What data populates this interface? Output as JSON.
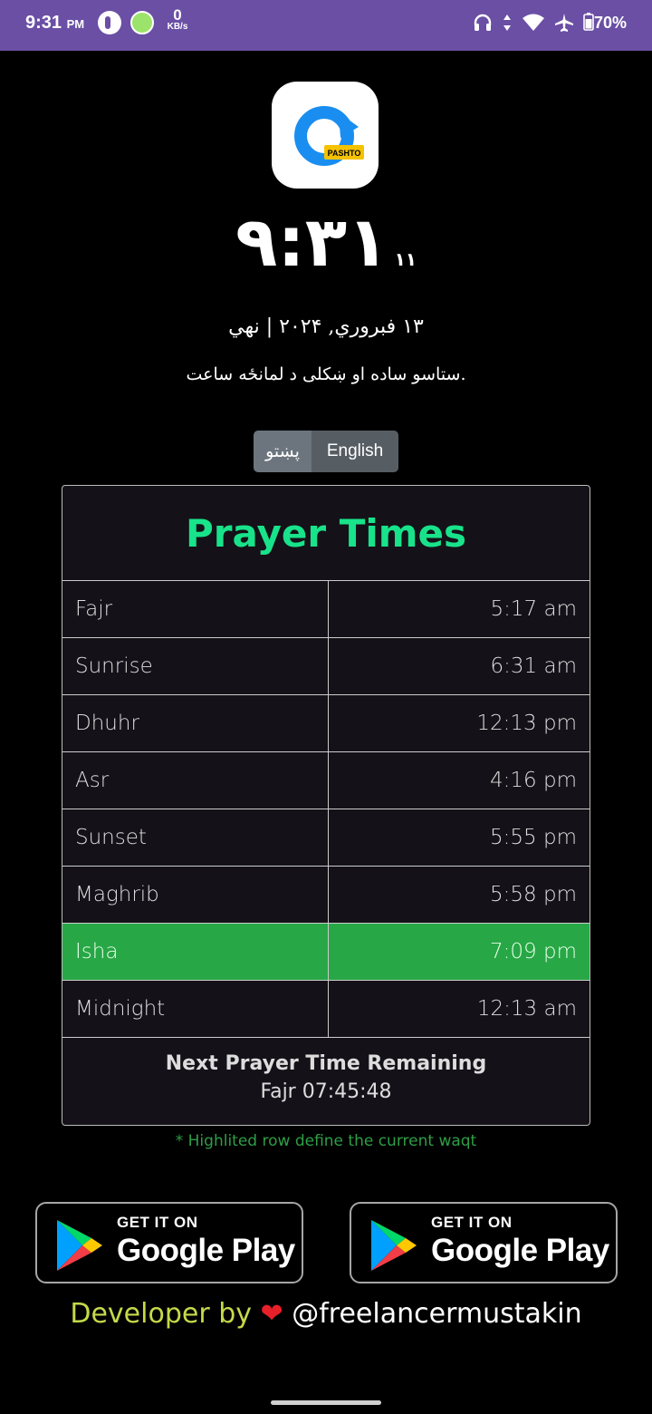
{
  "status_bar": {
    "time": "9:31",
    "ampm": "PM",
    "net_speed_value": "0",
    "net_speed_unit": "KB/s",
    "battery": "70%"
  },
  "app_icon": {
    "badge": "PASHTO"
  },
  "clock": {
    "main": "٩:٣١",
    "seconds": "١١"
  },
  "date": "١٣ فبروري, ٢٠٢۴ | نهي",
  "tagline": "ستاسو ساده او ښکلی د لمانځه ساعت.",
  "language": {
    "pashto": "پښتو",
    "english": "English"
  },
  "prayer_table": {
    "title": "Prayer Times",
    "rows": [
      {
        "name": "Fajr",
        "time": "5:17 am"
      },
      {
        "name": "Sunrise",
        "time": "6:31 am"
      },
      {
        "name": "Dhuhr",
        "time": "12:13 pm"
      },
      {
        "name": "Asr",
        "time": "4:16 pm"
      },
      {
        "name": "Sunset",
        "time": "5:55 pm"
      },
      {
        "name": "Maghrib",
        "time": "5:58 pm"
      },
      {
        "name": "Isha",
        "time": "7:09 pm"
      },
      {
        "name": "Midnight",
        "time": "12:13 am"
      }
    ],
    "next_title": "Next Prayer Time Remaining",
    "next_value": "Fajr 07:45:48"
  },
  "note": "* Highlited row define the current waqt",
  "store_buttons": [
    {
      "small": "GET IT ON",
      "big": "Google Play"
    },
    {
      "small": "GET IT ON",
      "big": "Google Play"
    }
  ],
  "developer": {
    "label": "Developer by",
    "handle": "@freelancermustakin"
  },
  "colors": {
    "status_bar": "#6a4fa5",
    "title_green": "#18e38a",
    "active_row": "#27a745"
  }
}
